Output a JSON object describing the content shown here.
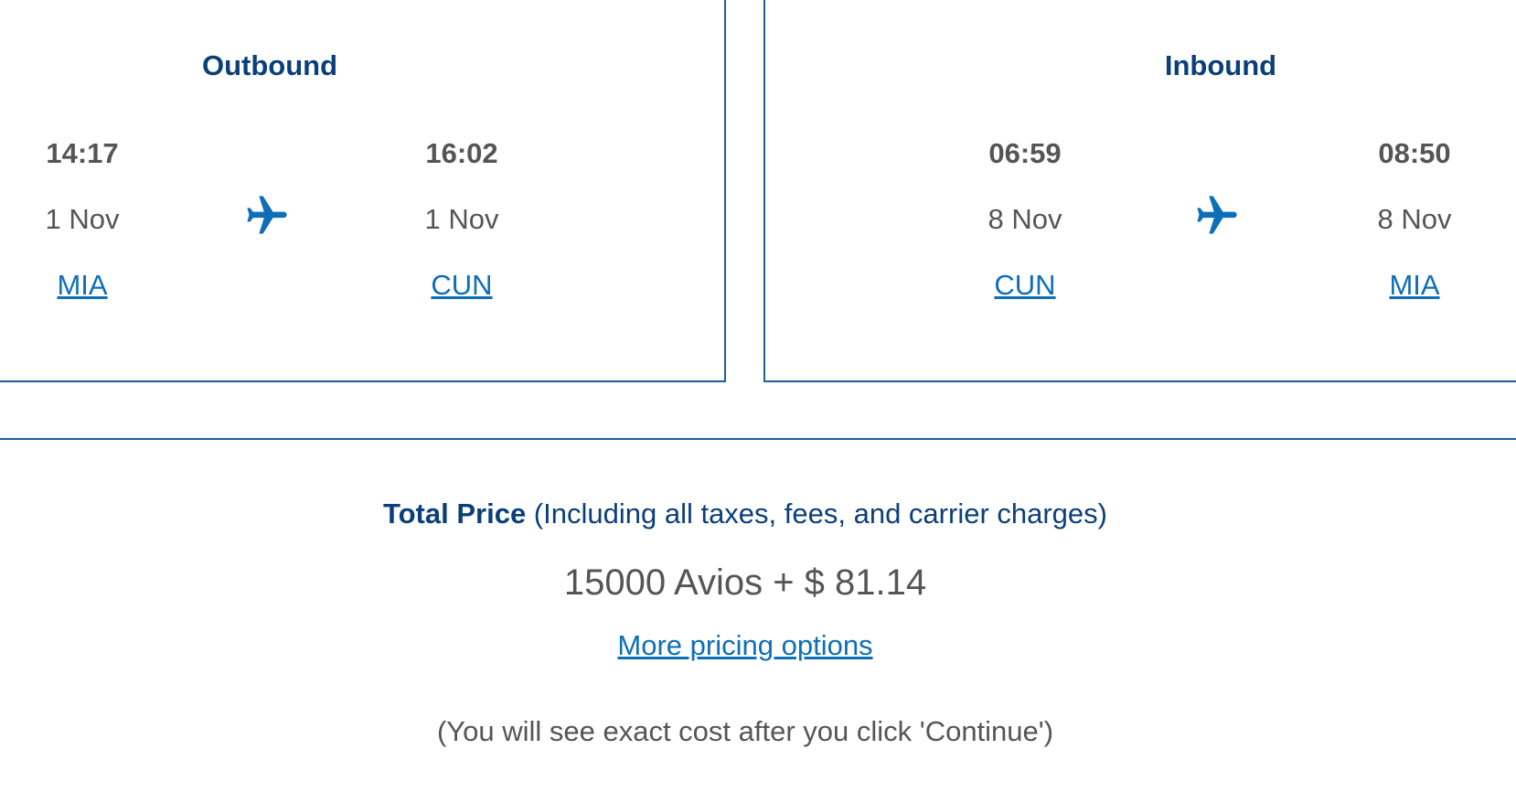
{
  "outbound": {
    "title": "Outbound",
    "departure": {
      "time": "14:17",
      "date": "1 Nov",
      "airport": "MIA"
    },
    "arrival": {
      "time": "16:02",
      "date": "1 Nov",
      "airport": "CUN"
    }
  },
  "inbound": {
    "title": "Inbound",
    "departure": {
      "time": "06:59",
      "date": "8 Nov",
      "airport": "CUN"
    },
    "arrival": {
      "time": "08:50",
      "date": "8 Nov",
      "airport": "MIA"
    }
  },
  "price": {
    "label": "Total Price",
    "qualifier": " (Including all taxes, fees, and carrier charges)",
    "value": "15000 Avios + $ 81.14",
    "more_options": "More pricing options",
    "note": "(You will see exact cost after you click 'Continue')"
  },
  "colors": {
    "accent": "#0d6fb8",
    "heading": "#0b3f7a",
    "border": "#1f5f95",
    "text": "#555555"
  },
  "icons": {
    "flight": "airplane-icon"
  }
}
